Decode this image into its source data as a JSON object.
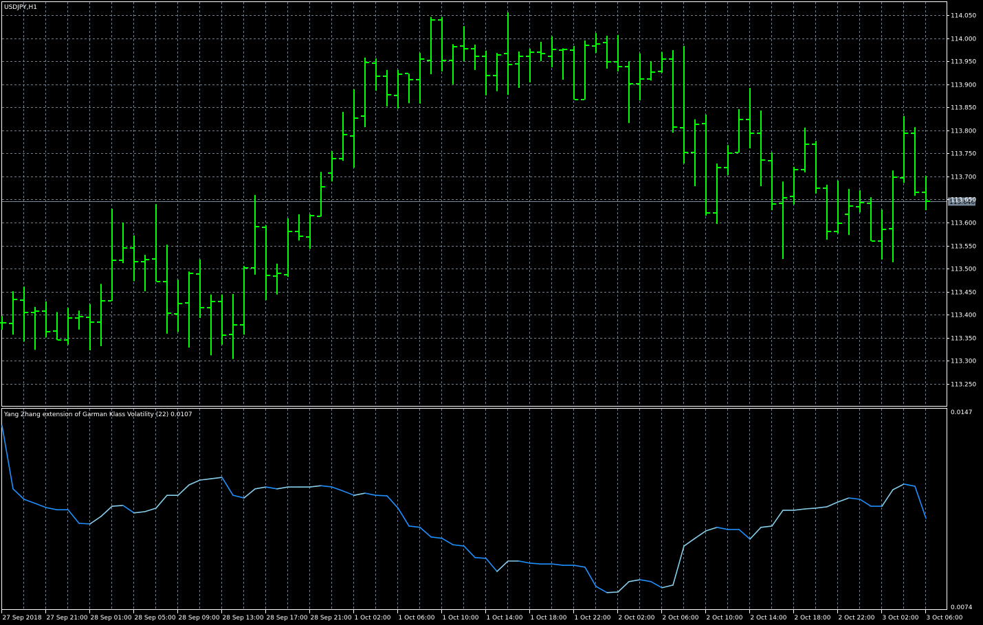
{
  "window": {
    "title": "USDJPY,H1"
  },
  "colors": {
    "background": "#000000",
    "bars": "#00FF00",
    "grid": "#708090",
    "frame": "#FFFFFF",
    "bid_line": "#778899",
    "indicator_down": "#1E90FF",
    "indicator_up": "#87CEEB"
  },
  "chart_data": [
    {
      "type": "ohlc",
      "title": "USDJPY,H1",
      "symbol": "USDJPY",
      "timeframe": "H1",
      "bid": {
        "value": 113.646,
        "label": "113.646"
      },
      "ylim": [
        113.215,
        114.07
      ],
      "grid": true,
      "y_ticks": [
        "114.050",
        "114.000",
        "113.950",
        "113.900",
        "113.850",
        "113.800",
        "113.750",
        "113.700",
        "113.650",
        "113.600",
        "113.550",
        "113.500",
        "113.450",
        "113.400",
        "113.350",
        "113.300",
        "113.250"
      ],
      "x_labels": [
        "27 Sep 2018",
        "27 Sep 21:00",
        "28 Sep 01:00",
        "28 Sep 05:00",
        "28 Sep 09:00",
        "28 Sep 13:00",
        "28 Sep 17:00",
        "28 Sep 21:00",
        "1 Oct 02:00",
        "1 Oct 06:00",
        "1 Oct 10:00",
        "1 Oct 14:00",
        "1 Oct 18:00",
        "1 Oct 22:00",
        "2 Oct 02:00",
        "2 Oct 06:00",
        "2 Oct 10:00",
        "2 Oct 14:00",
        "2 Oct 18:00",
        "2 Oct 22:00",
        "3 Oct 02:00",
        "3 Oct 06:00"
      ],
      "x_label_every_bars": 4,
      "ohlc": [
        [
          113.382,
          113.397,
          113.368,
          113.382
        ],
        [
          113.381,
          113.451,
          113.357,
          113.433
        ],
        [
          113.432,
          113.461,
          113.342,
          113.405
        ],
        [
          113.405,
          113.417,
          113.324,
          113.408
        ],
        [
          113.408,
          113.429,
          113.351,
          113.363
        ],
        [
          113.365,
          113.406,
          113.345,
          113.345
        ],
        [
          113.345,
          113.415,
          113.335,
          113.393
        ],
        [
          113.393,
          113.409,
          113.368,
          113.396
        ],
        [
          113.394,
          113.423,
          113.323,
          113.384
        ],
        [
          113.384,
          113.467,
          113.332,
          113.43
        ],
        [
          113.43,
          113.63,
          113.43,
          113.518
        ],
        [
          113.518,
          113.6,
          113.512,
          113.545
        ],
        [
          113.545,
          113.572,
          113.473,
          113.515
        ],
        [
          113.515,
          113.53,
          113.451,
          113.52
        ],
        [
          113.521,
          113.64,
          113.472,
          113.472
        ],
        [
          113.472,
          113.552,
          113.359,
          113.403
        ],
        [
          113.402,
          113.476,
          113.363,
          113.424
        ],
        [
          113.426,
          113.494,
          113.329,
          113.49
        ],
        [
          113.488,
          113.52,
          113.393,
          113.415
        ],
        [
          113.415,
          113.444,
          113.312,
          113.429
        ],
        [
          113.429,
          113.444,
          113.335,
          113.356
        ],
        [
          113.357,
          113.445,
          113.304,
          113.378
        ],
        [
          113.378,
          113.506,
          113.357,
          113.502
        ],
        [
          113.502,
          113.66,
          113.487,
          113.591
        ],
        [
          113.59,
          113.594,
          113.432,
          113.485
        ],
        [
          113.484,
          113.511,
          113.444,
          113.49
        ],
        [
          113.487,
          113.609,
          113.482,
          113.581
        ],
        [
          113.581,
          113.618,
          113.561,
          113.57
        ],
        [
          113.569,
          113.618,
          113.543,
          113.615
        ],
        [
          113.613,
          113.71,
          113.613,
          113.677
        ],
        [
          113.707,
          113.755,
          113.689,
          113.739
        ],
        [
          113.739,
          113.84,
          113.734,
          113.791
        ],
        [
          113.788,
          113.889,
          113.719,
          113.826
        ],
        [
          113.831,
          113.958,
          113.807,
          113.947
        ],
        [
          113.946,
          113.956,
          113.886,
          113.917
        ],
        [
          113.917,
          113.931,
          113.852,
          113.877
        ],
        [
          113.876,
          113.931,
          113.847,
          113.922
        ],
        [
          113.923,
          113.923,
          113.859,
          113.91
        ],
        [
          113.91,
          113.968,
          113.858,
          113.955
        ],
        [
          113.952,
          114.046,
          113.922,
          114.04
        ],
        [
          114.04,
          114.046,
          113.928,
          113.952
        ],
        [
          113.952,
          113.987,
          113.9,
          113.981
        ],
        [
          113.983,
          114.026,
          113.95,
          113.977
        ],
        [
          113.977,
          113.986,
          113.931,
          113.961
        ],
        [
          113.961,
          113.973,
          113.876,
          113.919
        ],
        [
          113.919,
          113.968,
          113.885,
          113.964
        ],
        [
          113.967,
          114.056,
          113.877,
          113.943
        ],
        [
          113.944,
          113.971,
          113.892,
          113.961
        ],
        [
          113.961,
          113.977,
          113.904,
          113.97
        ],
        [
          113.97,
          113.992,
          113.95,
          113.967
        ],
        [
          113.961,
          114.004,
          113.937,
          113.975
        ],
        [
          113.974,
          113.978,
          113.91,
          113.975
        ],
        [
          113.974,
          113.983,
          113.867,
          113.867
        ],
        [
          113.867,
          113.995,
          113.867,
          113.984
        ],
        [
          113.983,
          114.011,
          113.968,
          113.987
        ],
        [
          113.99,
          114.005,
          113.934,
          113.949
        ],
        [
          113.949,
          114.007,
          113.928,
          113.938
        ],
        [
          113.938,
          113.95,
          113.816,
          113.901
        ],
        [
          113.901,
          113.967,
          113.865,
          113.911
        ],
        [
          113.911,
          113.95,
          113.908,
          113.926
        ],
        [
          113.928,
          113.97,
          113.925,
          113.955
        ],
        [
          113.955,
          113.974,
          113.795,
          113.807
        ],
        [
          113.806,
          113.983,
          113.728,
          113.752
        ],
        [
          113.752,
          113.824,
          113.679,
          113.813
        ],
        [
          113.815,
          113.834,
          113.615,
          113.621
        ],
        [
          113.621,
          113.728,
          113.597,
          113.719
        ],
        [
          113.719,
          113.768,
          113.703,
          113.751
        ],
        [
          113.752,
          113.846,
          113.752,
          113.824
        ],
        [
          113.824,
          113.892,
          113.761,
          113.794
        ],
        [
          113.794,
          113.843,
          113.679,
          113.736
        ],
        [
          113.734,
          113.752,
          113.627,
          113.64
        ],
        [
          113.642,
          113.689,
          113.521,
          113.654
        ],
        [
          113.657,
          113.721,
          113.639,
          113.715
        ],
        [
          113.715,
          113.806,
          113.709,
          113.77
        ],
        [
          113.77,
          113.777,
          113.663,
          113.675
        ],
        [
          113.675,
          113.682,
          113.563,
          113.581
        ],
        [
          113.581,
          113.691,
          113.576,
          113.599
        ],
        [
          113.618,
          113.673,
          113.573,
          113.636
        ],
        [
          113.634,
          113.67,
          113.622,
          113.643
        ],
        [
          113.642,
          113.655,
          113.56,
          113.56
        ],
        [
          113.56,
          113.628,
          113.52,
          113.585
        ],
        [
          113.587,
          113.713,
          113.514,
          113.698
        ],
        [
          113.697,
          113.831,
          113.686,
          113.794
        ],
        [
          113.794,
          113.807,
          113.658,
          113.666
        ],
        [
          113.666,
          113.701,
          113.627,
          113.646
        ]
      ]
    },
    {
      "type": "line",
      "title": "Yang Zhang extension of Garman Klass Volatility (22) 0.0107",
      "name": "Yang Zhang extension of Garman Klass Volatility",
      "period": 22,
      "current_value": 0.0107,
      "ylim": [
        0.0074,
        0.0147
      ],
      "y_ticks": [
        "0.0147",
        "0.0074"
      ],
      "values": [
        0.01416,
        0.0118,
        0.01141,
        0.01126,
        0.0111,
        0.01102,
        0.01102,
        0.01051,
        0.01049,
        0.01077,
        0.01115,
        0.01118,
        0.0109,
        0.01095,
        0.01108,
        0.01156,
        0.01156,
        0.01195,
        0.01213,
        0.01218,
        0.01223,
        0.01156,
        0.01146,
        0.0118,
        0.01187,
        0.0118,
        0.01187,
        0.01187,
        0.01187,
        0.01192,
        0.01187,
        0.01172,
        0.01156,
        0.01164,
        0.01156,
        0.01154,
        0.01108,
        0.01041,
        0.01036,
        0.01,
        0.00995,
        0.00971,
        0.00966,
        0.00923,
        0.0092,
        0.00871,
        0.0091,
        0.0091,
        0.00902,
        0.00899,
        0.00899,
        0.00894,
        0.00894,
        0.00887,
        0.00815,
        0.00792,
        0.00794,
        0.00833,
        0.0084,
        0.00833,
        0.0081,
        0.0082,
        0.00966,
        0.00995,
        0.01023,
        0.01036,
        0.01028,
        0.01028,
        0.00992,
        0.01036,
        0.01041,
        0.011,
        0.011,
        0.01105,
        0.01108,
        0.01113,
        0.01131,
        0.01146,
        0.01141,
        0.01115,
        0.01115,
        0.01177,
        0.01198,
        0.0119,
        0.0107
      ]
    }
  ]
}
